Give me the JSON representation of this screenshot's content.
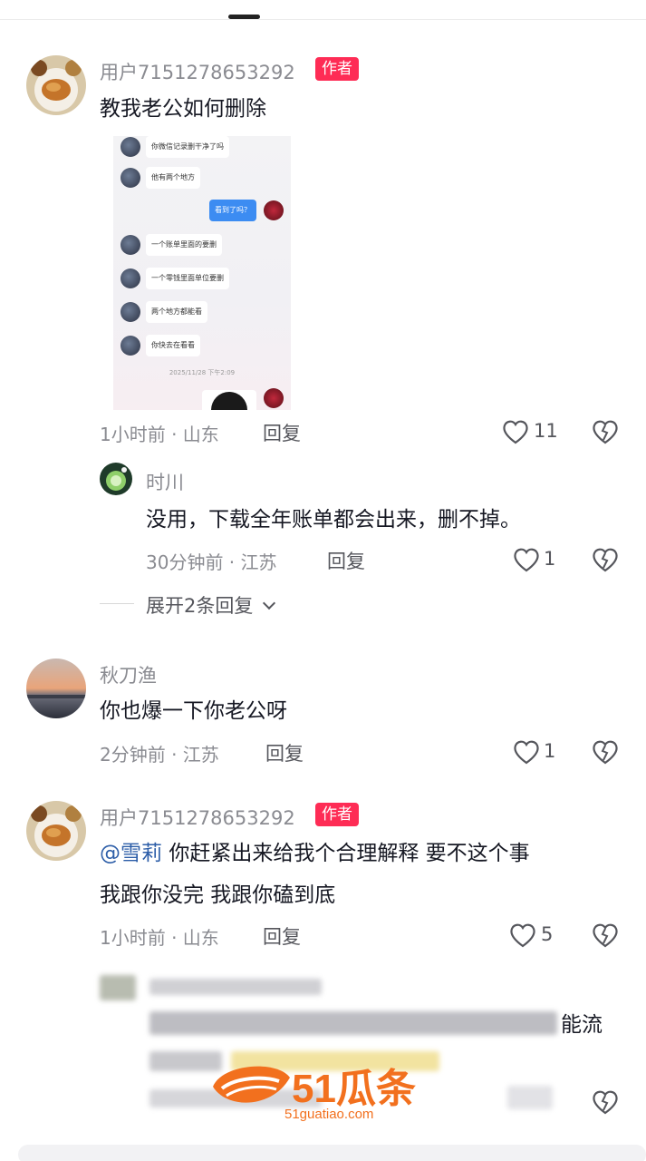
{
  "comments": [
    {
      "username": "用户7151278653292",
      "badge": "作者",
      "text": "教我老公如何删除",
      "time_location": "1小时前 · 山东",
      "reply_label": "回复",
      "likes": "11",
      "chat_screenshot": {
        "messages": [
          "你微信记录删干净了吗",
          "他有两个地方",
          "一个账单里面的要删",
          "一个零钱里面单位要删",
          "两个地方都能看",
          "你快去在看看"
        ],
        "my_message": "看到了吗？",
        "timestamp": "2025/11/28 下午2:09"
      },
      "sub_reply": {
        "username": "时川",
        "text": "没用，下载全年账单都会出来，删不掉。",
        "time_location": "30分钟前 · 江苏",
        "reply_label": "回复",
        "likes": "1"
      },
      "expand_label": "展开2条回复"
    },
    {
      "username": "秋刀渔",
      "text": "你也爆一下你老公呀",
      "time_location": "2分钟前 · 江苏",
      "reply_label": "回复",
      "likes": "1"
    },
    {
      "username": "用户7151278653292",
      "badge": "作者",
      "mention": "@雪莉",
      "text_line1": "你赶紧出来给我个合理解释 要不这个事",
      "text_line2": "我跟你没完 我跟你磕到底",
      "time_location": "1小时前 · 山东",
      "reply_label": "回复",
      "likes": "5"
    }
  ],
  "partial_comment": {
    "visible_text": "能流"
  },
  "watermark": {
    "brand": "51瓜条",
    "url": "51guatiao.com"
  },
  "colors": {
    "author_badge": "#fe2c55",
    "mention": "#2d5ea8",
    "watermark": "#f2701e"
  }
}
